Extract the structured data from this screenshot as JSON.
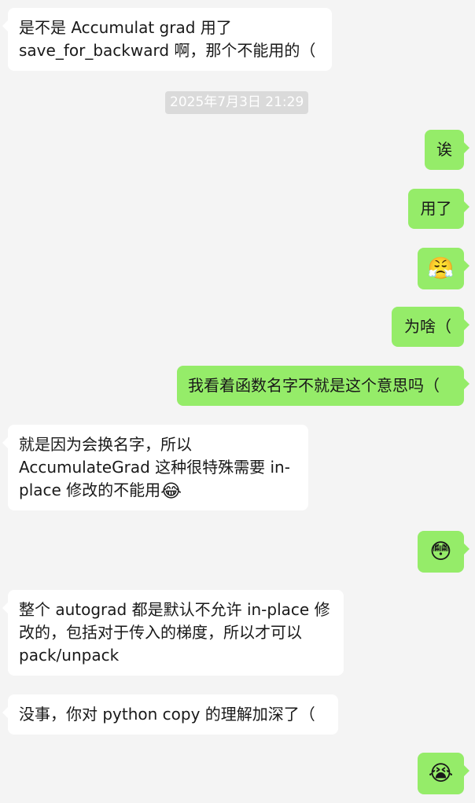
{
  "messages": [
    {
      "text": "是不是 Accumulat grad 用了 save_for_backward 啊，那个不能用的（"
    },
    {
      "text": "2025年7月3日 21:29"
    },
    {
      "text": "诶"
    },
    {
      "text": "用了"
    },
    {
      "text": "😤"
    },
    {
      "text": "为啥（"
    },
    {
      "text": "我看着函数名字不就是这个意思吗（"
    },
    {
      "text": "就是因为会换名字，所以 AccumulateGrad 这种很特殊需要 in-place 修改的不能用"
    },
    {
      "text": "😂"
    },
    {
      "text": "😳"
    },
    {
      "text": "整个 autograd 都是默认不允许 in-place 修改的，包括对于传入的梯度，所以才可以 pack/unpack"
    },
    {
      "text": "没事，你对 python copy 的理解加深了（"
    },
    {
      "text": "😭"
    }
  ]
}
